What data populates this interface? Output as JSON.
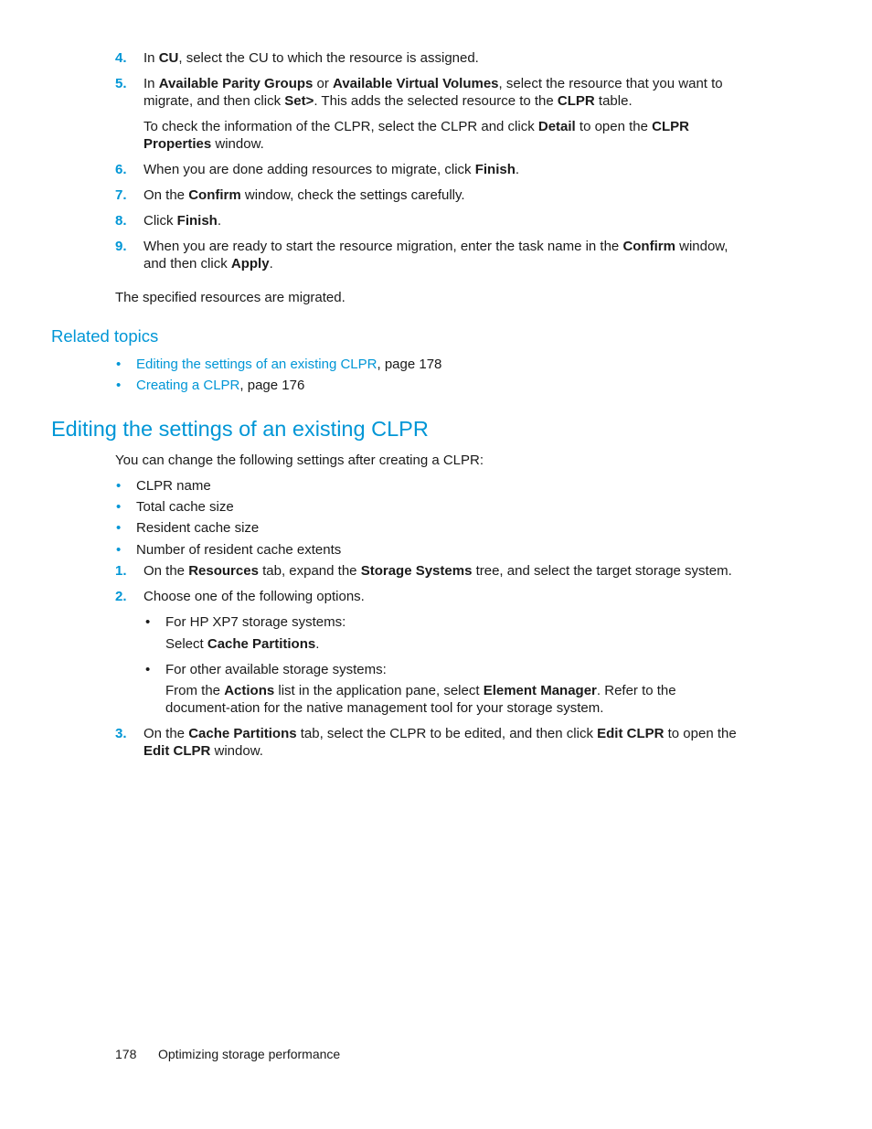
{
  "steps_top": [
    {
      "num": "4.",
      "parts": [
        [
          "In ",
          ""
        ],
        [
          "CU",
          "b"
        ],
        [
          ", select the CU to which the resource is assigned.",
          ""
        ]
      ]
    },
    {
      "num": "5.",
      "parts": [
        [
          "In ",
          ""
        ],
        [
          "Available Parity Groups",
          "b"
        ],
        [
          " or ",
          ""
        ],
        [
          "Available Virtual Volumes",
          "b"
        ],
        [
          ", select the resource that you want to migrate, and then click ",
          ""
        ],
        [
          "Set>",
          "b"
        ],
        [
          ". This adds the selected resource to the ",
          ""
        ],
        [
          "CLPR",
          "b"
        ],
        [
          " table.",
          ""
        ]
      ]
    },
    {
      "num": "",
      "parts": [
        [
          "To check the information of the CLPR, select the CLPR and click ",
          ""
        ],
        [
          "Detail",
          "b"
        ],
        [
          " to open the ",
          ""
        ],
        [
          "CLPR Properties",
          "b"
        ],
        [
          " window.",
          ""
        ]
      ]
    },
    {
      "num": "6.",
      "parts": [
        [
          "When you are done adding resources to migrate, click ",
          ""
        ],
        [
          "Finish",
          "b"
        ],
        [
          ".",
          ""
        ]
      ]
    },
    {
      "num": "7.",
      "parts": [
        [
          "On the ",
          ""
        ],
        [
          "Confirm",
          "b"
        ],
        [
          " window, check the settings carefully.",
          ""
        ]
      ]
    },
    {
      "num": "8.",
      "parts": [
        [
          "Click ",
          ""
        ],
        [
          "Finish",
          "b"
        ],
        [
          ".",
          ""
        ]
      ]
    },
    {
      "num": "9.",
      "parts": [
        [
          "When you are ready to start the resource migration, enter the task name in the ",
          ""
        ],
        [
          "Confirm",
          "b"
        ],
        [
          " window, and then click ",
          ""
        ],
        [
          "Apply",
          "b"
        ],
        [
          ".",
          ""
        ]
      ]
    }
  ],
  "result_text": "The specified resources are migrated.",
  "related": {
    "heading": "Related topics",
    "items": [
      {
        "link": "Editing the settings of an existing CLPR",
        "suffix": ", page 178"
      },
      {
        "link": "Creating a CLPR",
        "suffix": ", page 176"
      }
    ]
  },
  "section": {
    "heading": "Editing the settings of an existing CLPR",
    "intro": "You can change the following settings after creating a CLPR:",
    "settings": [
      "CLPR name",
      "Total cache size",
      "Resident cache size",
      "Number of resident cache extents"
    ],
    "bullet_glyph": "•"
  },
  "steps_bottom": [
    {
      "num": "1.",
      "parts": [
        [
          "On the ",
          ""
        ],
        [
          "Resources",
          "b"
        ],
        [
          " tab, expand the ",
          ""
        ],
        [
          "Storage Systems",
          "b"
        ],
        [
          " tree, and select the target storage system.",
          ""
        ]
      ]
    },
    {
      "num": "2.",
      "parts": [
        [
          "Choose one of the following options.",
          ""
        ]
      ]
    }
  ],
  "options": [
    {
      "label": "For HP XP7 storage systems:",
      "detail": [
        [
          "Select ",
          ""
        ],
        [
          "Cache Partitions",
          "b"
        ],
        [
          ".",
          ""
        ]
      ]
    },
    {
      "label": "For other available storage systems:",
      "detail": [
        [
          "From the ",
          ""
        ],
        [
          "Actions",
          "b"
        ],
        [
          " list in the application pane, select ",
          ""
        ],
        [
          "Element Manager",
          "b"
        ],
        [
          ". Refer to the document-ation for the native management tool for your storage system.",
          ""
        ]
      ]
    }
  ],
  "step3": {
    "num": "3.",
    "parts": [
      [
        "On the ",
        ""
      ],
      [
        "Cache Partitions",
        "b"
      ],
      [
        " tab, select the CLPR to be edited, and then click ",
        ""
      ],
      [
        "Edit CLPR",
        "b"
      ],
      [
        " to open the ",
        ""
      ],
      [
        "Edit CLPR",
        "b"
      ],
      [
        " window.",
        ""
      ]
    ]
  },
  "footer": {
    "page_number": "178",
    "chapter": "Optimizing storage performance"
  },
  "colors": {
    "accent": "#0096d6",
    "text": "#1a1a1a"
  }
}
